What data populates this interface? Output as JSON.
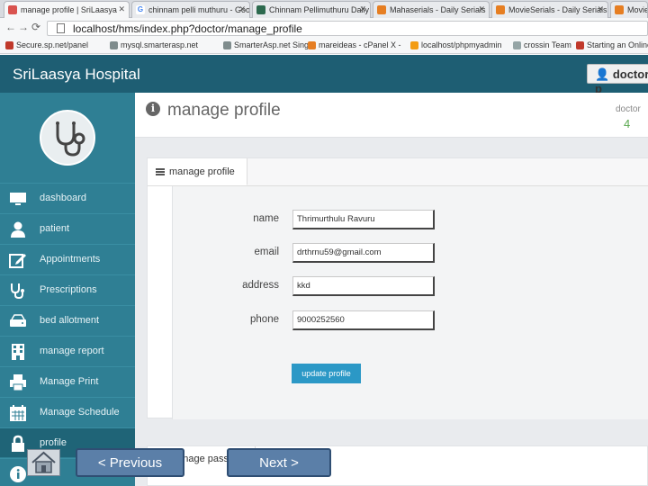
{
  "browser": {
    "tabs": [
      {
        "title": "manage profile | SriLaasya",
        "active": true,
        "icon_color": "#d9534f"
      },
      {
        "title": "chinnam pelli muthuru - Goo",
        "active": false,
        "icon_color": "#4285f4",
        "icon_text": "G"
      },
      {
        "title": "Chinnam Pellimuthuru Daily",
        "active": false,
        "icon_color": "#2d6a4f"
      },
      {
        "title": "Mahaserials - Daily Serials",
        "active": false,
        "icon_color": "#e67e22"
      },
      {
        "title": "MovieSerials - Daily Serials",
        "active": false,
        "icon_color": "#e67e22"
      },
      {
        "title": "MovieS",
        "active": false,
        "icon_color": "#e67e22"
      }
    ],
    "url": "localhost/hms/index.php?doctor/manage_profile",
    "bookmarks": [
      {
        "label": "Secure.sp.net/panel",
        "color": "#c0392b"
      },
      {
        "label": "mysql.smarterasp.net",
        "color": "#7f8c8d"
      },
      {
        "label": "SmarterAsp.net Single",
        "color": "#7f8c8d"
      },
      {
        "label": "mareideas - cPanel X -",
        "color": "#e67e22"
      },
      {
        "label": "localhost/phpmyadmin",
        "color": "#f39c12"
      },
      {
        "label": "crossin Team",
        "color": "#95a5a6"
      },
      {
        "label": "Starting an Online",
        "color": "#c0392b"
      }
    ]
  },
  "app": {
    "brand": "SriLaasya Hospital",
    "user_button": "doctor p"
  },
  "sidebar": {
    "items": [
      {
        "label": "dashboard",
        "icon": "monitor-icon"
      },
      {
        "label": "patient",
        "icon": "user-icon"
      },
      {
        "label": "Appointments",
        "icon": "edit-icon"
      },
      {
        "label": "Prescriptions",
        "icon": "stethoscope-icon"
      },
      {
        "label": "bed allotment",
        "icon": "hdd-icon"
      },
      {
        "label": "manage report",
        "icon": "building-icon"
      },
      {
        "label": "Manage Print",
        "icon": "print-icon"
      },
      {
        "label": "Manage Schedule",
        "icon": "calendar-icon"
      },
      {
        "label": "profile",
        "icon": "lock-icon"
      }
    ]
  },
  "page": {
    "title": "manage profile",
    "role_label": "doctor",
    "role_count": "4"
  },
  "panel": {
    "tab_label": "manage profile",
    "fields": [
      {
        "label": "name",
        "value": "Thrimurthulu Ravuru"
      },
      {
        "label": "email",
        "value": "drthrnu59@gmail.com"
      },
      {
        "label": "address",
        "value": "kkd"
      },
      {
        "label": "phone",
        "value": "9000252560"
      }
    ],
    "submit_label": "update profile"
  },
  "panel2": {
    "tab_label": "manage pass"
  },
  "slide_nav": {
    "previous_label": "< Previous",
    "next_label": "Next >"
  }
}
